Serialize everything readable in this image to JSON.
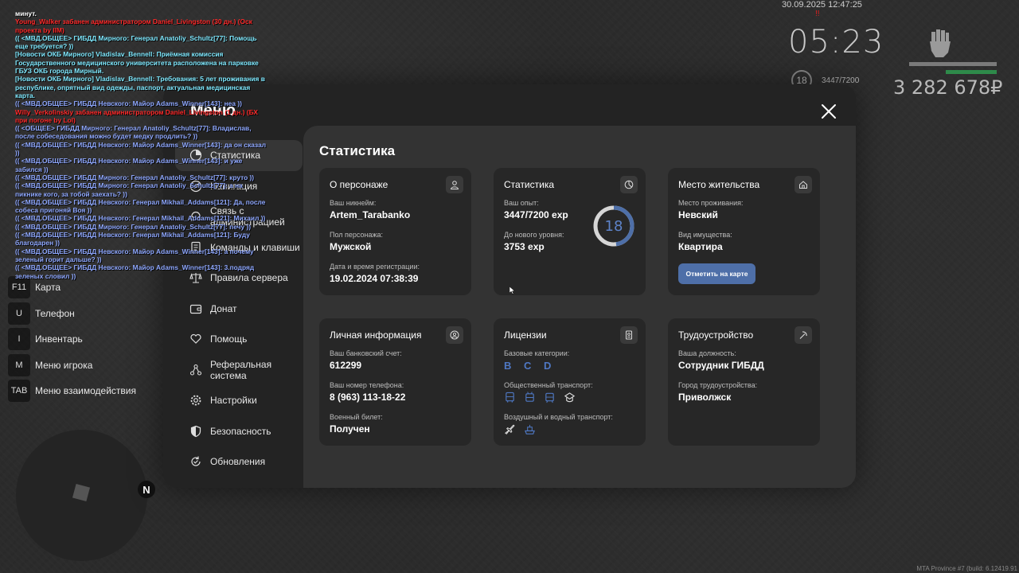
{
  "hud": {
    "datetime": "30.09.2025 12:47:25",
    "marker": "!!",
    "time": "05:23",
    "level": "18",
    "exp": "3447/7200",
    "money": "3 282 678₽",
    "build": "MTA Province #7 (build: 6.12419.91"
  },
  "chat": [
    {
      "t": "минут.",
      "c": "w"
    },
    {
      "t": "Young_Walker забанен администратором Daniel_Livingston (30 дн.) (Оск проекта by IIM)",
      "c": "r"
    },
    {
      "t": "(( <МВД.ОБЩЕЕ> ГИБДД Мирного: Генерал Anatoliy_Schultz[77]: Помощь еще требуется? ))",
      "c": "c"
    },
    {
      "t": "[Новости ОКБ Мирного] Vladislav_Bennell: Приёмная комиссия Государственного медицинского университета расположена на парковке ГБУЗ ОКБ города Мирный.",
      "c": "c"
    },
    {
      "t": "[Новости ОКБ Мирного] Vladislav_Bennell: Требования: 5 лет проживания в республике, опрятный вид одежды, паспорт, актуальная медицинская карта.",
      "c": "c"
    },
    {
      "t": "(( <МВД.ОБЩЕЕ> ГИБДД Невского: Майор Adams_Winner[143]: неа ))",
      "c": "b"
    },
    {
      "t": "Willy_Verkolinskiy забанен администратором Daniel_Livingston (1 дн.) (БХ при погоне by Lol)",
      "c": "r"
    },
    {
      "t": "(( <ОБЩЕЕ> ГИБДД Мирного: Генерал Anatoliy_Schultz[77]: Владислав, после собеседования можно будет медку продлить? ))",
      "c": "b"
    },
    {
      "t": "(( <МВД.ОБЩЕЕ> ГИБДД Невского: Майор Adams_Winner[143]: да он сказал ))",
      "c": "b"
    },
    {
      "t": "(( <МВД.ОБЩЕЕ> ГИБДД Невского: Майор Adams_Winner[143]: и уже забился ))",
      "c": "b"
    },
    {
      "t": "(( <МВД.ОБЩЕЕ> ГИБДД Мирного: Генерал Anatoliy_Schultz[77]: круто ))",
      "c": "b"
    },
    {
      "t": "(( <МВД.ОБЩЕЕ> ГИБДД Мирного: Генерал Anatoliy_Schultz[77]: а на пикнике кого, за тобой заехать? ))",
      "c": "b"
    },
    {
      "t": "(( <МВД.ОБЩЕЕ> ГИБДД Невского: Генерал Mikhail_Addams[121]: Да, после собеса пригоняй Воя ))",
      "c": "b"
    },
    {
      "t": "(( <МВД.ОБЩЕЕ> ГИБДД Невского: Генерал Mikhail_Addams[121]: Михаил ))",
      "c": "b"
    },
    {
      "t": "(( <МВД.ОБЩЕЕ> ГИБДД Мирного: Генерал Anatoliy_Schultz[77]: печу ))",
      "c": "b"
    },
    {
      "t": "(( <МВД.ОБЩЕЕ> ГИБДД Невского: Генерал Mikhail_Addams[121]: Буду благодарен ))",
      "c": "b"
    },
    {
      "t": "(( <МВД.ОБЩЕЕ> ГИБДД Невского: Майор Adams_Winner[143]: а почему зеленый горит дальше? ))",
      "c": "b"
    },
    {
      "t": "(( <МВД.ОБЩЕЕ> ГИБДД Невского: Майор Adams_Winner[143]: 3.подряд зеленых словил ))",
      "c": "b"
    }
  ],
  "keys": [
    {
      "key": "F11",
      "label": "Карта"
    },
    {
      "key": "U",
      "label": "Телефон"
    },
    {
      "key": "I",
      "label": "Инвентарь"
    },
    {
      "key": "M",
      "label": "Меню игрока"
    },
    {
      "key": "TAB",
      "label": "Меню взаимодействия"
    }
  ],
  "minimap": {
    "north": "N"
  },
  "menu": {
    "title": "Меню",
    "sidebar": [
      {
        "label": "Статистика",
        "icon": "stats-icon"
      },
      {
        "label": "Навигация",
        "icon": "compass-icon"
      },
      {
        "label": "Связь с администрацией",
        "icon": "headset-icon"
      },
      {
        "label": "Команды и клавиши",
        "icon": "document-icon"
      },
      {
        "label": "Правила сервера",
        "icon": "scales-icon"
      },
      {
        "label": "Донат",
        "icon": "wallet-icon"
      },
      {
        "label": "Помощь",
        "icon": "heart-hand-icon"
      },
      {
        "label": "Реферальная система",
        "icon": "network-icon"
      },
      {
        "label": "Настройки",
        "icon": "gear-icon"
      },
      {
        "label": "Безопасность",
        "icon": "shield-icon"
      },
      {
        "label": "Обновления",
        "icon": "refresh-icon"
      }
    ],
    "content_title": "Статистика",
    "character": {
      "title": "О персонаже",
      "nick_label": "Ваш никнейм:",
      "nick": "Artem_Tarabanko",
      "gender_label": "Пол персонажа:",
      "gender": "Мужской",
      "reg_label": "Дата и время регистрации:",
      "reg": "19.02.2024 07:38:39"
    },
    "stats": {
      "title": "Статистика",
      "exp_label": "Ваш опыт:",
      "exp": "3447/7200 exp",
      "next_label": "До нового уровня:",
      "next": "3753 exp",
      "level": "18",
      "progress": 0.47875,
      "ring_color": "#4e6fa8"
    },
    "residence": {
      "title": "Место жительства",
      "place_label": "Место проживания:",
      "place": "Невский",
      "property_label": "Вид имущества:",
      "property": "Квартира",
      "button": "Отметить на карте"
    },
    "personal": {
      "title": "Личная информация",
      "bank_label": "Ваш банковский счет:",
      "bank": "612299",
      "phone_label": "Ваш номер телефона:",
      "phone": "8 (963) 113-18-22",
      "military_label": "Военный билет:",
      "military": "Получен"
    },
    "licenses": {
      "title": "Лицензии",
      "base_label": "Базовые категории:",
      "base": "B C D",
      "public_label": "Общественный транспорт:",
      "air_label": "Воздушный и водный транспорт:"
    },
    "job": {
      "title": "Трудоустройство",
      "position_label": "Ваша должность:",
      "position": "Сотрудник ГИБДД",
      "city_label": "Город трудоустройства:",
      "city": "Приволжск"
    }
  }
}
